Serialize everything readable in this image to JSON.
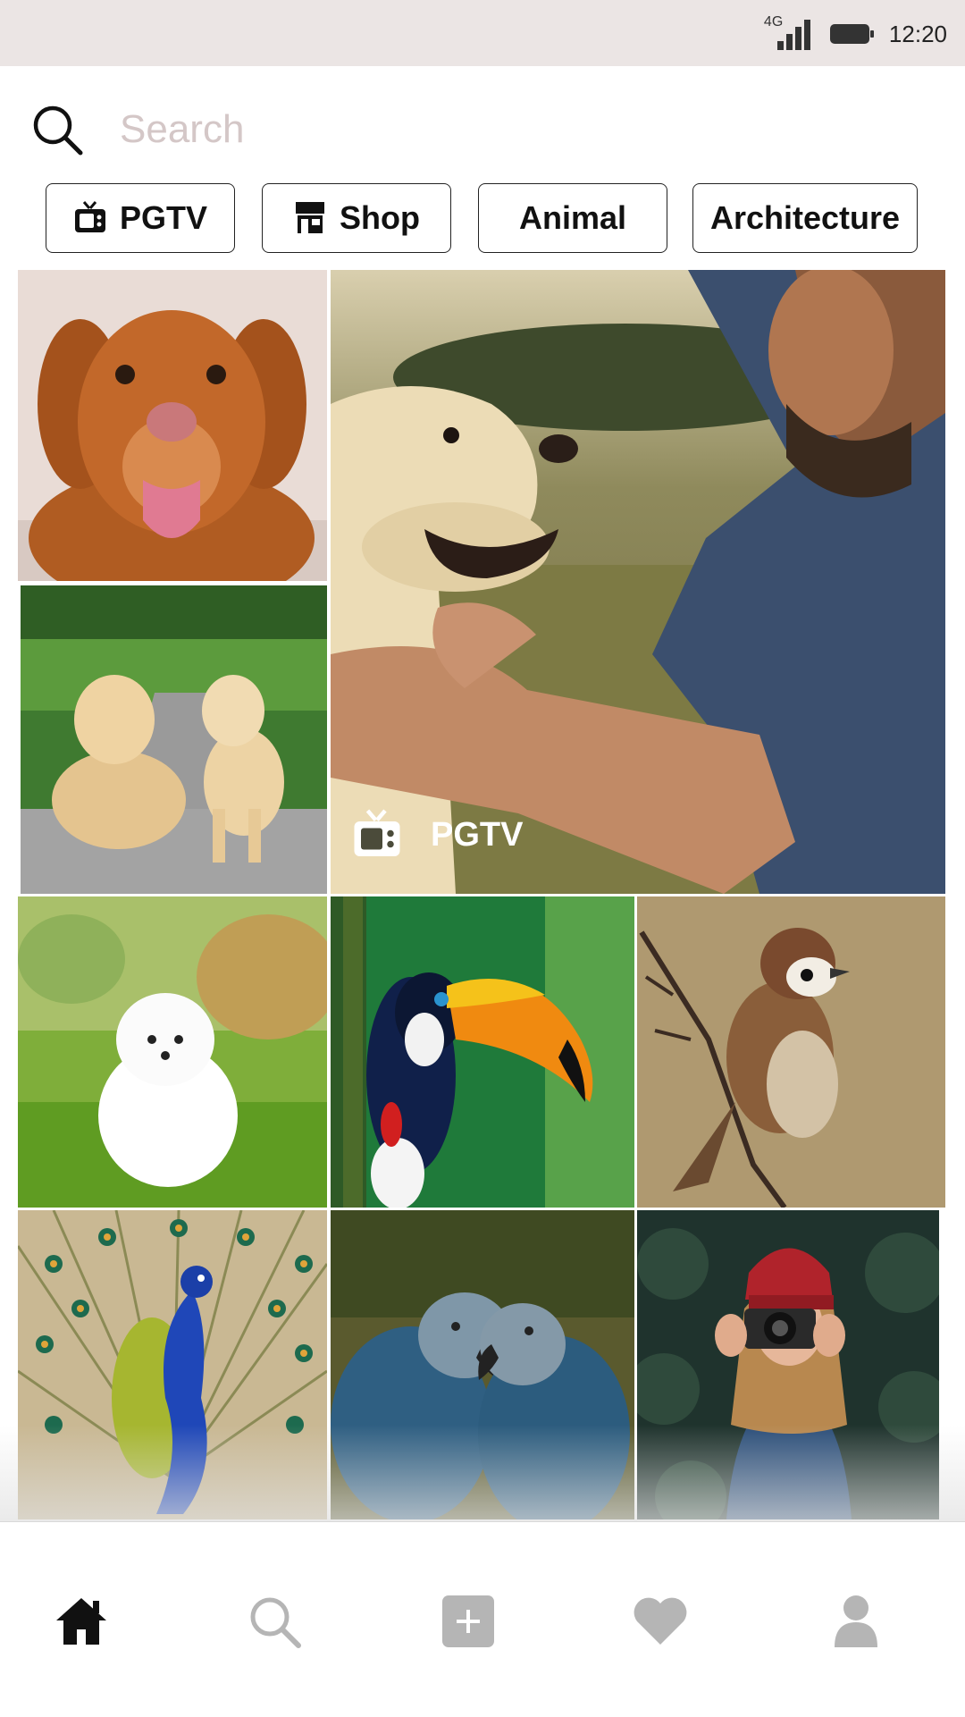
{
  "status_bar": {
    "network": "4G",
    "time": "12:20"
  },
  "search": {
    "placeholder": "Search",
    "value": ""
  },
  "chips": [
    {
      "label": "PGTV",
      "icon": "tv-icon"
    },
    {
      "label": "Shop",
      "icon": "shop-icon"
    },
    {
      "label": "Animal"
    },
    {
      "label": "Architecture"
    }
  ],
  "grid": {
    "featured": {
      "label": "PGTV",
      "icon": "tv-icon",
      "photo": "man with labrador dog in park"
    },
    "tiles": [
      {
        "photo": "golden dog"
      },
      {
        "photo": "two labradors"
      },
      {
        "photo": "white pomeranian puppy"
      },
      {
        "photo": "toucan"
      },
      {
        "photo": "sparrow on branch"
      },
      {
        "photo": "peacock"
      },
      {
        "photo": "two blue parrots"
      },
      {
        "photo": "woman with camera"
      }
    ]
  },
  "nav": {
    "items": [
      {
        "name": "home",
        "icon": "home-icon",
        "active": true
      },
      {
        "name": "search",
        "icon": "search-icon",
        "active": false
      },
      {
        "name": "add",
        "icon": "plus-square-icon",
        "active": false
      },
      {
        "name": "activity",
        "icon": "heart-icon",
        "active": false
      },
      {
        "name": "profile",
        "icon": "user-icon",
        "active": false
      }
    ]
  },
  "colors": {
    "status_bar": "#ebe5e4",
    "placeholder": "#d4c7c7",
    "active_icon": "#111111",
    "inactive_icon": "#b5b5b5"
  }
}
